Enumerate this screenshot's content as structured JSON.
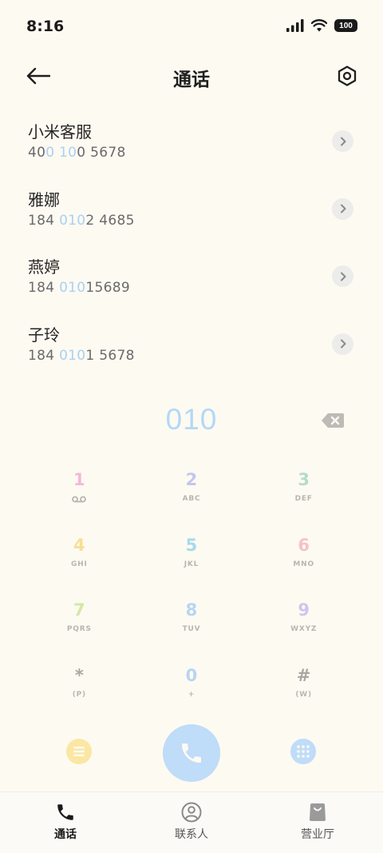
{
  "status_bar": {
    "time": "8:16",
    "battery": "100"
  },
  "header": {
    "title": "通话"
  },
  "contacts": [
    {
      "name": "小米客服",
      "number_parts": [
        "40",
        "0 10",
        "0 5678"
      ]
    },
    {
      "name": "雅娜",
      "number_parts": [
        "184 ",
        "010",
        "2 4685"
      ]
    },
    {
      "name": "燕婷",
      "number_parts": [
        "184 ",
        "010",
        "15689"
      ]
    },
    {
      "name": "子玲",
      "number_parts": [
        "184 ",
        "010",
        "1 5678"
      ]
    }
  ],
  "dial": {
    "number": "010"
  },
  "keys": [
    {
      "digit": "1",
      "sub": "",
      "color": "#f4b8d6"
    },
    {
      "digit": "2",
      "sub": "ABC",
      "color": "#c4c6ee"
    },
    {
      "digit": "3",
      "sub": "DEF",
      "color": "#b4dccb"
    },
    {
      "digit": "4",
      "sub": "GHI",
      "color": "#f7df93"
    },
    {
      "digit": "5",
      "sub": "JKL",
      "color": "#a8d9ea"
    },
    {
      "digit": "6",
      "sub": "MNO",
      "color": "#f6c2c4"
    },
    {
      "digit": "7",
      "sub": "PQRS",
      "color": "#d4e7a6"
    },
    {
      "digit": "8",
      "sub": "TUV",
      "color": "#b7d5f3"
    },
    {
      "digit": "9",
      "sub": "WXYZ",
      "color": "#cdc6ef"
    },
    {
      "digit": "*",
      "sub": "(P)",
      "color": "#a9a7a2"
    },
    {
      "digit": "0",
      "sub": "+",
      "color": "#b7d5f3"
    },
    {
      "digit": "#",
      "sub": "(W)",
      "color": "#a9a7a2"
    }
  ],
  "nav": {
    "calls": "通话",
    "contacts": "联系人",
    "store": "营业厅"
  },
  "colors": {
    "background": "#fdfaf2",
    "highlight": "#a9d1f4",
    "call_button": "#bfdcf9",
    "menu_button": "#fbe7a3"
  },
  "icons": {
    "back": "arrow-left-icon",
    "settings": "hexagon-gear-icon",
    "detail": "chevron-right-icon",
    "backspace": "backspace-icon",
    "voicemail": "voicemail-icon",
    "menu": "list-icon",
    "call": "phone-icon",
    "keypad": "dialpad-icon",
    "nav_calls": "phone-icon",
    "nav_contacts": "person-circle-icon",
    "nav_store": "shopping-bag-icon"
  }
}
